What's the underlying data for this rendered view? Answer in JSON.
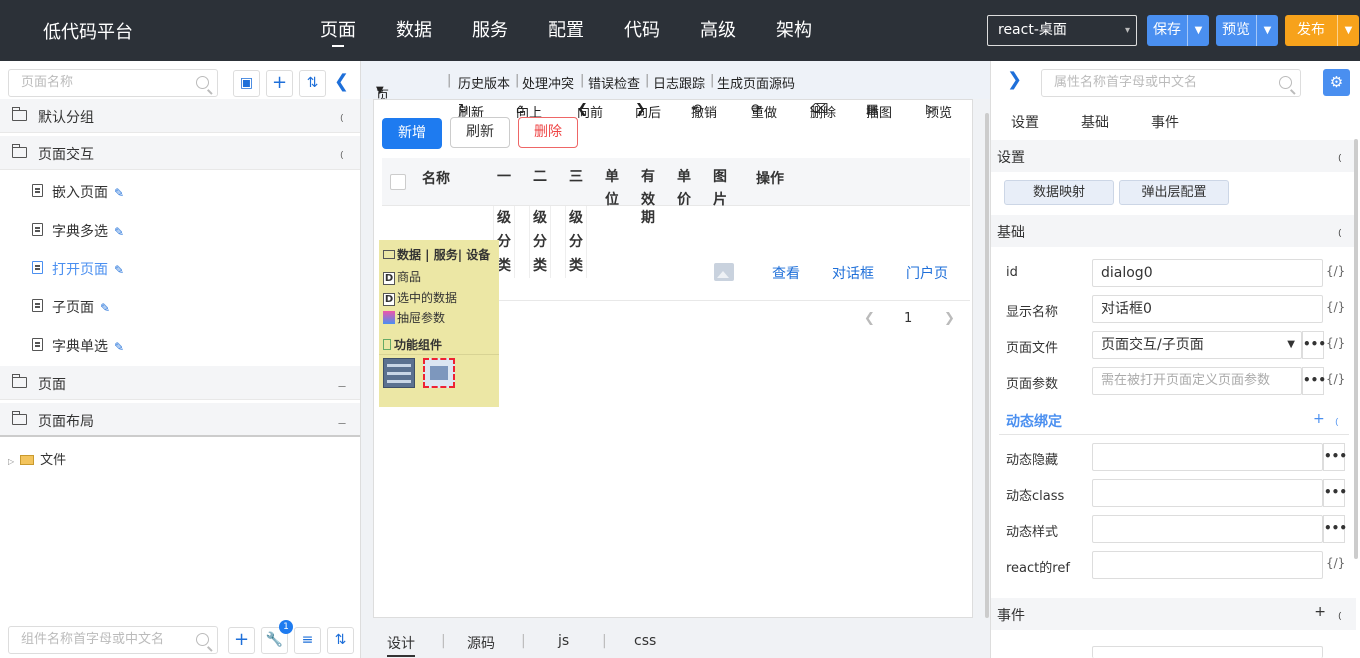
{
  "app": {
    "title": "低代码平台"
  },
  "nav": [
    "页面",
    "数据",
    "服务",
    "配置",
    "代码",
    "高级",
    "架构"
  ],
  "header": {
    "platform_select": "react-桌面",
    "save": "保存",
    "preview": "预览",
    "publish": "发布"
  },
  "left": {
    "search_placeholder": "页面名称",
    "groups": [
      {
        "label": "默认分组"
      },
      {
        "label": "页面交互"
      },
      {
        "label": "页面"
      },
      {
        "label": "页面布局"
      }
    ],
    "items": [
      "嵌入页面",
      "字典多选",
      "打开页面",
      "子页面",
      "字典单选"
    ],
    "file_label": "文件",
    "bottom_search_placeholder": "组件名称首字母或中文名",
    "badge_count": "1"
  },
  "center": {
    "toolbar1": [
      "页面结构",
      "历史版本",
      "处理冲突",
      "错误检查",
      "日志跟踪",
      "生成页面源码"
    ],
    "toolbar2": [
      "刷新",
      "向上",
      "向前",
      "向后",
      "撤销",
      "重做",
      "删除",
      "插图",
      "预览"
    ],
    "buttons": {
      "add": "新增",
      "refresh": "刷新",
      "delete": "删除"
    },
    "table": {
      "col_name": "名称",
      "col_op": "操作",
      "header_cols": [
        "一",
        "二",
        "三",
        "单",
        "有",
        "单",
        "图"
      ],
      "header_cols_row2": [
        "位",
        "效",
        "价",
        "片"
      ],
      "vertical": {
        "c1": [
          "级",
          "分",
          "类"
        ],
        "c2": [
          "级",
          "分",
          "类"
        ],
        "c3": [
          "级",
          "分",
          "类"
        ],
        "c5": [
          "期"
        ]
      },
      "row_links": [
        "查看",
        "对话框",
        "门户页"
      ]
    },
    "pager": {
      "page": "1"
    },
    "yellow_panel": {
      "head": "数据 | 服务| 设备",
      "items": [
        "商品",
        "选中的数据",
        "抽屉参数"
      ],
      "section": "功能组件"
    },
    "bottom_tabs": [
      "设计",
      "源码",
      "js",
      "css"
    ]
  },
  "right": {
    "search_placeholder": "属性名称首字母或中文名",
    "tabs": [
      "设置",
      "基础",
      "事件"
    ],
    "section_settings": "设置",
    "btn_mapping": "数据映射",
    "btn_popup": "弹出层配置",
    "section_basic": "基础",
    "props": {
      "id_label": "id",
      "id_value": "dialog0",
      "name_label": "显示名称",
      "name_value": "对话框0",
      "file_label": "页面文件",
      "file_value": "页面交互/子页面",
      "param_label": "页面参数",
      "param_placeholder": "需在被打开页面定义页面参数"
    },
    "dynamic": "动态绑定",
    "dyn_props": [
      "动态隐藏",
      "动态class",
      "动态样式",
      "react的ref"
    ],
    "section_event": "事件",
    "curly": "{/}"
  }
}
